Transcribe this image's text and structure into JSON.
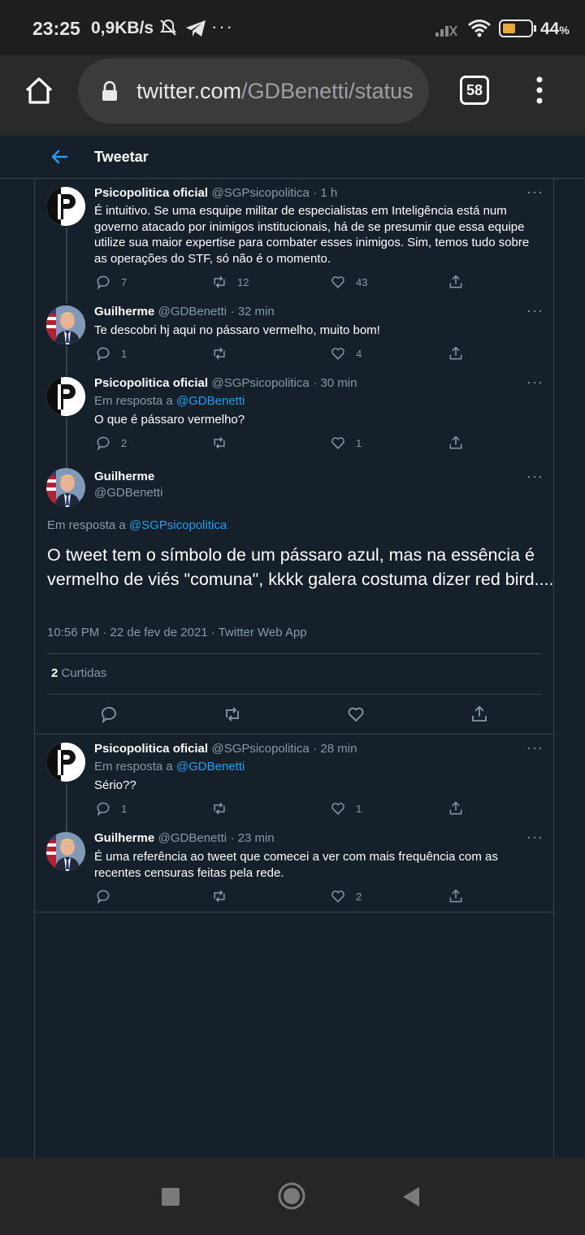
{
  "status_bar": {
    "time": "23:25",
    "net_speed": "0,9KB/s",
    "battery": "44",
    "battery_unit": "%"
  },
  "browser": {
    "url_domain": "twitter.com",
    "url_path": "/GDBenetti/status",
    "tab_count": "58"
  },
  "header": {
    "title": "Tweetar"
  },
  "tweets": [
    {
      "name": "Psicopolitica oficial",
      "handle": "@SGPsicopolitica",
      "time": "· 1 h",
      "text": "É intuitivo. Se uma esquipe militar de especialistas em Inteligência está num governo atacado por inimigos institucionais, há de se presumir que essa equipe utilize sua maior expertise para combater esses inimigos. Sim, temos tudo sobre as operações do STF, só não é o momento.",
      "replies": "7",
      "retweets": "12",
      "likes": "43"
    },
    {
      "name": "Guilherme",
      "handle": "@GDBenetti",
      "time": "· 32 min",
      "text": "Te descobri hj aqui no pássaro vermelho, muito bom!",
      "replies": "1",
      "retweets": "",
      "likes": "4"
    },
    {
      "name": "Psicopolitica oficial",
      "handle": "@SGPsicopolitica",
      "time": "· 30 min",
      "reply_prefix": "Em resposta a",
      "reply_to": "@GDBenetti",
      "text": "O que é pássaro vermelho?",
      "replies": "2",
      "retweets": "",
      "likes": "1"
    }
  ],
  "focus": {
    "name": "Guilherme",
    "handle": "@GDBenetti",
    "reply_prefix": "Em resposta a",
    "reply_to": "@SGPsicopolitica",
    "text": "O tweet tem o símbolo de um pássaro azul, mas na essência é vermelho de viés \"comuna\", kkkk galera costuma dizer red bird....",
    "timestamp": "10:56 PM · 22 de fev de 2021 · Twitter Web App",
    "retweet_count": "2",
    "retweet_label": "Curtidas"
  },
  "replies": [
    {
      "name": "Psicopolitica oficial",
      "handle": "@SGPsicopolitica",
      "time": "· 28 min",
      "reply_prefix": "Em resposta a",
      "reply_to": "@GDBenetti",
      "text": "Sério??",
      "replies": "1",
      "retweets": "",
      "likes": "1"
    },
    {
      "name": "Guilherme",
      "handle": "@GDBenetti",
      "time": "· 23 min",
      "text": "É uma referência ao tweet que comecei a ver com mais frequência com as recentes censuras feitas pela rede.",
      "replies": "",
      "retweets": "",
      "likes": "2"
    }
  ],
  "colors": {
    "background": "#15202b",
    "border": "#38444d",
    "accent": "#1da1f2",
    "muted": "#8899a6",
    "battery_fill": "#e8a93a"
  },
  "icons": [
    "home-icon",
    "lock-icon",
    "menu-dots-icon",
    "back-arrow-icon",
    "reply-icon",
    "retweet-icon",
    "like-icon",
    "share-icon",
    "more-icon",
    "nav-square-icon",
    "nav-circle-icon",
    "nav-back-icon"
  ]
}
